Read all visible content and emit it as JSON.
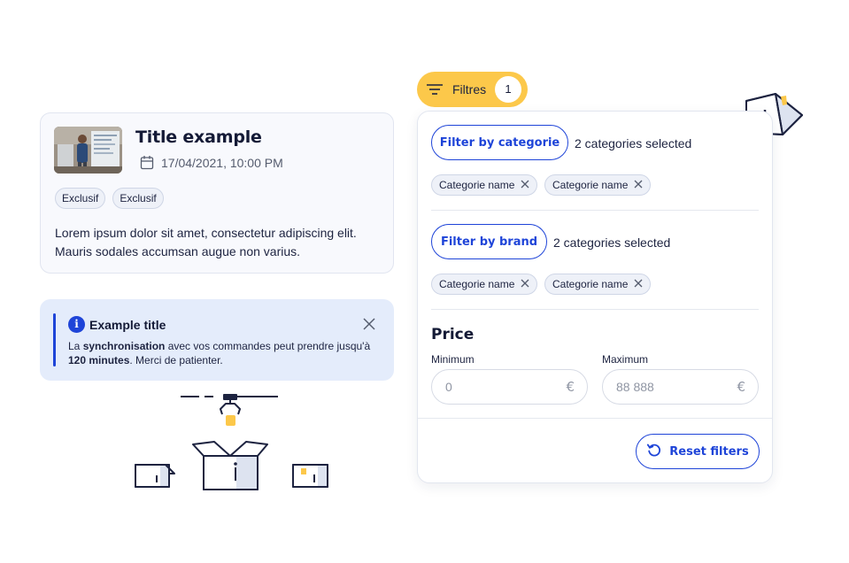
{
  "article": {
    "title": "Title example",
    "date": "17/04/2021, 10:00 PM",
    "tags": [
      "Exclusif",
      "Exclusif"
    ],
    "body": "Lorem ipsum dolor sit amet, consectetur adipiscing elit. Mauris sodales accumsan augue non varius."
  },
  "alert": {
    "title": "Example title",
    "text_before": "La ",
    "text_bold1": "synchronisation",
    "text_middle": " avec vos commandes peut prendre jusqu'à ",
    "text_bold2": "120 minutes",
    "text_after": ". Merci de patienter."
  },
  "filters_button": {
    "label": "Filtres",
    "count": "1"
  },
  "filter_panel": {
    "category": {
      "button_label": "Filter by categorie",
      "selected_text": "2 categories selected",
      "chips": [
        "Categorie name",
        "Categorie name"
      ]
    },
    "brand": {
      "button_label": "Filter by brand",
      "selected_text": "2 categories selected",
      "chips": [
        "Categorie name",
        "Categorie name"
      ]
    },
    "price": {
      "title": "Price",
      "min_label": "Minimum",
      "min_placeholder": "0",
      "max_label": "Maximum",
      "max_placeholder": "88 888",
      "currency": "€"
    },
    "reset_label": "Reset filters"
  },
  "colors": {
    "accent": "#1e44d8",
    "yellow": "#fcc84a",
    "navy": "#1d2340",
    "alert_bg": "#e4ecfb"
  }
}
